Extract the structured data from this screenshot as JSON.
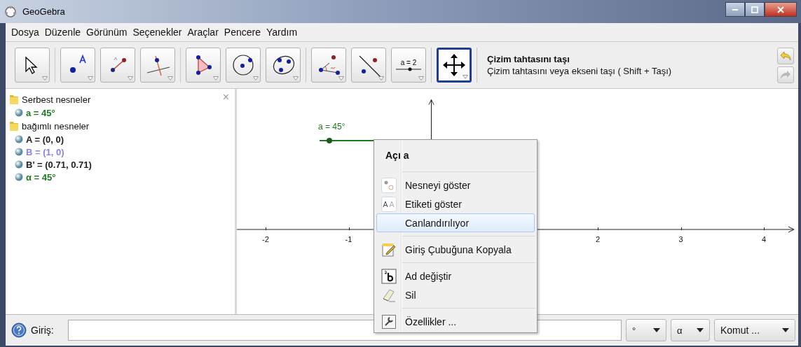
{
  "window": {
    "title": "GeoGebra"
  },
  "menu": [
    "Dosya",
    "Düzenle",
    "Görünüm",
    "Seçenekler",
    "Araçlar",
    "Pencere",
    "Yardım"
  ],
  "toolbar": {
    "groups": [
      [
        {
          "kind": "move",
          "selected": false
        }
      ],
      [
        {
          "kind": "point",
          "selected": false
        },
        {
          "kind": "segment",
          "selected": false
        },
        {
          "kind": "perpendicular",
          "selected": false
        }
      ],
      [
        {
          "kind": "polygon",
          "selected": false
        },
        {
          "kind": "circle",
          "selected": false
        },
        {
          "kind": "conic",
          "selected": false
        }
      ],
      [
        {
          "kind": "angle",
          "selected": false
        },
        {
          "kind": "reflect",
          "selected": false
        },
        {
          "kind": "slider",
          "selected": false,
          "label": "a = 2"
        }
      ],
      [
        {
          "kind": "move-view",
          "selected": true
        }
      ]
    ],
    "tool_title": "Çizim tahtasını taşı",
    "tool_help": "Çizim tahtasını veya ekseni taşı ( Shift + Taşı)"
  },
  "algebra": {
    "folders": [
      {
        "label": "Serbest nesneler",
        "children": [
          {
            "text": "a = 45°",
            "color": "#1e7a1e"
          }
        ]
      },
      {
        "label": "bağımlı nesneler",
        "children": [
          {
            "text": "A = (0, 0)",
            "color": "#222222"
          },
          {
            "text": "B = (1, 0)",
            "color": "#8484e6"
          },
          {
            "text": "B' = (0.71, 0.71)",
            "color": "#222222"
          },
          {
            "text": "α = 45°",
            "color": "#1e7a1e"
          }
        ]
      }
    ],
    "close": "×"
  },
  "graphics": {
    "slider": {
      "label": "a = 45°",
      "level": 0.15
    },
    "x_ticks": [
      "-2",
      "-1",
      "2",
      "3",
      "4"
    ]
  },
  "context_menu": {
    "title": "Açı a",
    "groups": [
      [
        {
          "kind": "show-object",
          "label": "Nesneyi göster",
          "highlighted": false
        },
        {
          "kind": "show-label",
          "label": "Etiketi göster",
          "highlighted": false
        },
        {
          "kind": "toggle",
          "label": "Canlandırılıyor",
          "highlighted": true
        }
      ],
      [
        {
          "kind": "copy",
          "label": "Giriş Çubuğuna Kopyala",
          "highlighted": false
        }
      ],
      [
        {
          "kind": "rename",
          "label": "Ad değiştir",
          "highlighted": false
        },
        {
          "kind": "delete",
          "label": "Sil",
          "highlighted": false
        }
      ],
      [
        {
          "kind": "properties",
          "label": "Özellikler ...",
          "highlighted": false
        }
      ]
    ]
  },
  "input_bar": {
    "label": "Giriş:",
    "dropdowns": [
      "°",
      "α",
      "Komut ..."
    ]
  }
}
